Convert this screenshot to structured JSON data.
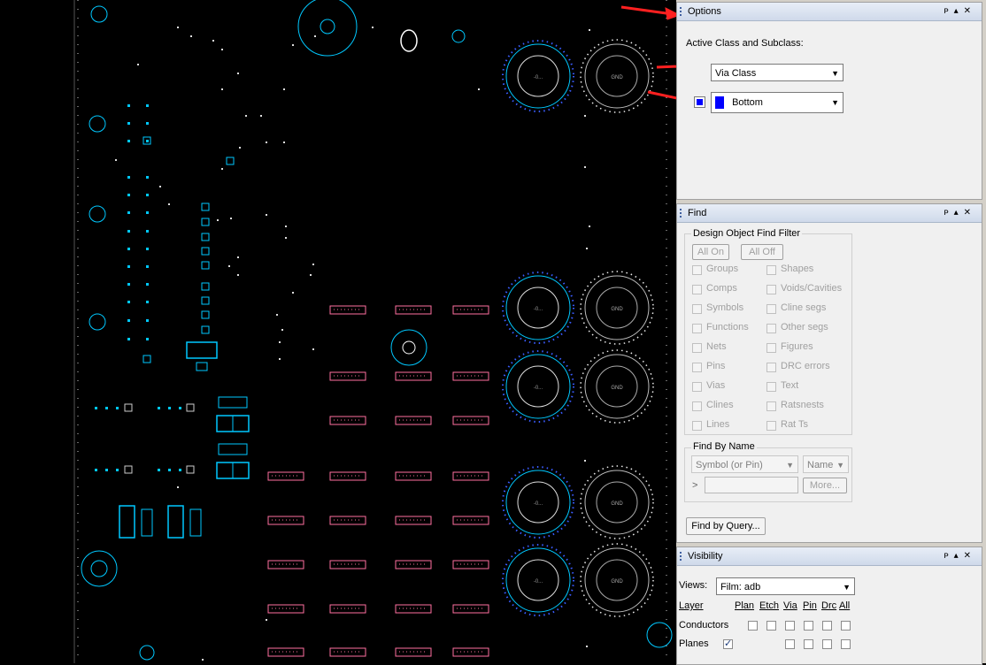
{
  "options_panel": {
    "title": "Options",
    "active_class_label": "Active Class and Subclass:",
    "class_value": "Via Class",
    "subclass_value": "Bottom",
    "subclass_color": "#0000ff"
  },
  "find_panel": {
    "title": "Find",
    "filter_group_label": "Design Object Find Filter",
    "all_on": "All On",
    "all_off": "All Off",
    "left_items": [
      "Groups",
      "Comps",
      "Symbols",
      "Functions",
      "Nets",
      "Pins",
      "Vias",
      "Clines",
      "Lines"
    ],
    "right_items": [
      "Shapes",
      "Voids/Cavities",
      "Cline segs",
      "Other segs",
      "Figures",
      "DRC errors",
      "Text",
      "Ratsnests",
      "Rat Ts"
    ],
    "find_by_name_label": "Find By Name",
    "symbol_select": "Symbol (or Pin)",
    "name_select": "Name",
    "more_button": "More...",
    "prompt_glyph": ">",
    "find_by_query_button": "Find by Query..."
  },
  "visibility_panel": {
    "title": "Visibility",
    "views_label": "Views:",
    "views_value": "Film: adb",
    "columns": [
      "Layer",
      "Plan",
      "Etch",
      "Via",
      "Pin",
      "Drc",
      "All"
    ],
    "rows": [
      {
        "label": "Conductors",
        "plan": false
      },
      {
        "label": "Planes",
        "plan": true
      }
    ]
  },
  "pcb_labels": {
    "gnd": "GND",
    "small": "-0..."
  },
  "colors": {
    "cyan": "#00c8ff",
    "pink": "#ff6fa0",
    "arrow": "#ff2020"
  }
}
